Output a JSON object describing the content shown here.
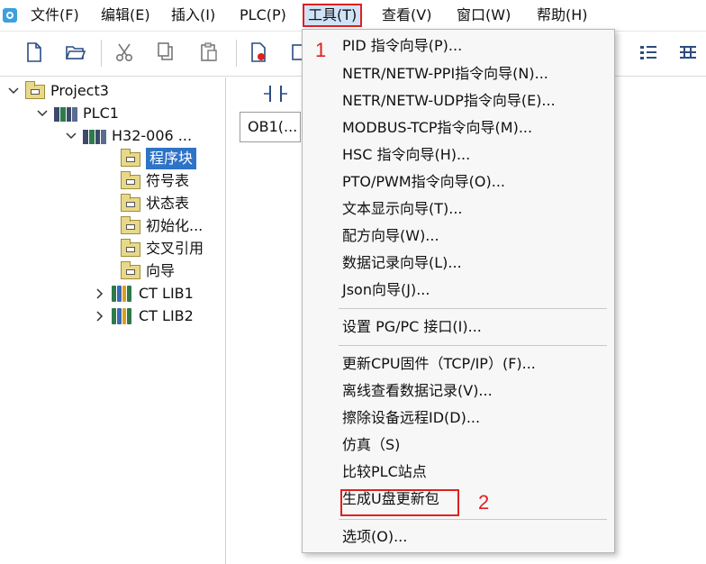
{
  "menubar": {
    "items": [
      {
        "label": "文件(F)"
      },
      {
        "label": "编辑(E)"
      },
      {
        "label": "插入(I)"
      },
      {
        "label": "PLC(P)"
      },
      {
        "label": "工具(T)"
      },
      {
        "label": "查看(V)"
      },
      {
        "label": "窗口(W)"
      },
      {
        "label": "帮助(H)"
      }
    ]
  },
  "tree": {
    "project": "Project3",
    "plc": "PLC1",
    "device": "H32-006 ...",
    "folders": [
      "程序块",
      "符号表",
      "状态表",
      "初始化...",
      "交叉引用",
      "向导"
    ],
    "libs": [
      "CT LIB1",
      "CT LIB2"
    ]
  },
  "editor": {
    "block_label": "OB1(..."
  },
  "dropdown": {
    "items": [
      "PID 指令向导(P)...",
      "NETR/NETW-PPI指令向导(N)...",
      "NETR/NETW-UDP指令向导(E)...",
      "MODBUS-TCP指令向导(M)...",
      "HSC 指令向导(H)...",
      "PTO/PWM指令向导(O)...",
      "文本显示向导(T)...",
      "配方向导(W)...",
      "数据记录向导(L)...",
      "Json向导(J)...",
      "设置 PG/PC 接口(I)...",
      "更新CPU固件（TCP/IP）(F)...",
      "离线查看数据记录(V)...",
      "擦除设备远程ID(D)...",
      "仿真（S)",
      "比较PLC站点",
      "生成U盘更新包",
      "选项(O)..."
    ]
  },
  "annotations": {
    "step1": "1",
    "step2": "2"
  },
  "colors": {
    "highlight": "#e02020",
    "selection": "#2f73c7",
    "menu_active_bg": "#cfe3f7"
  }
}
